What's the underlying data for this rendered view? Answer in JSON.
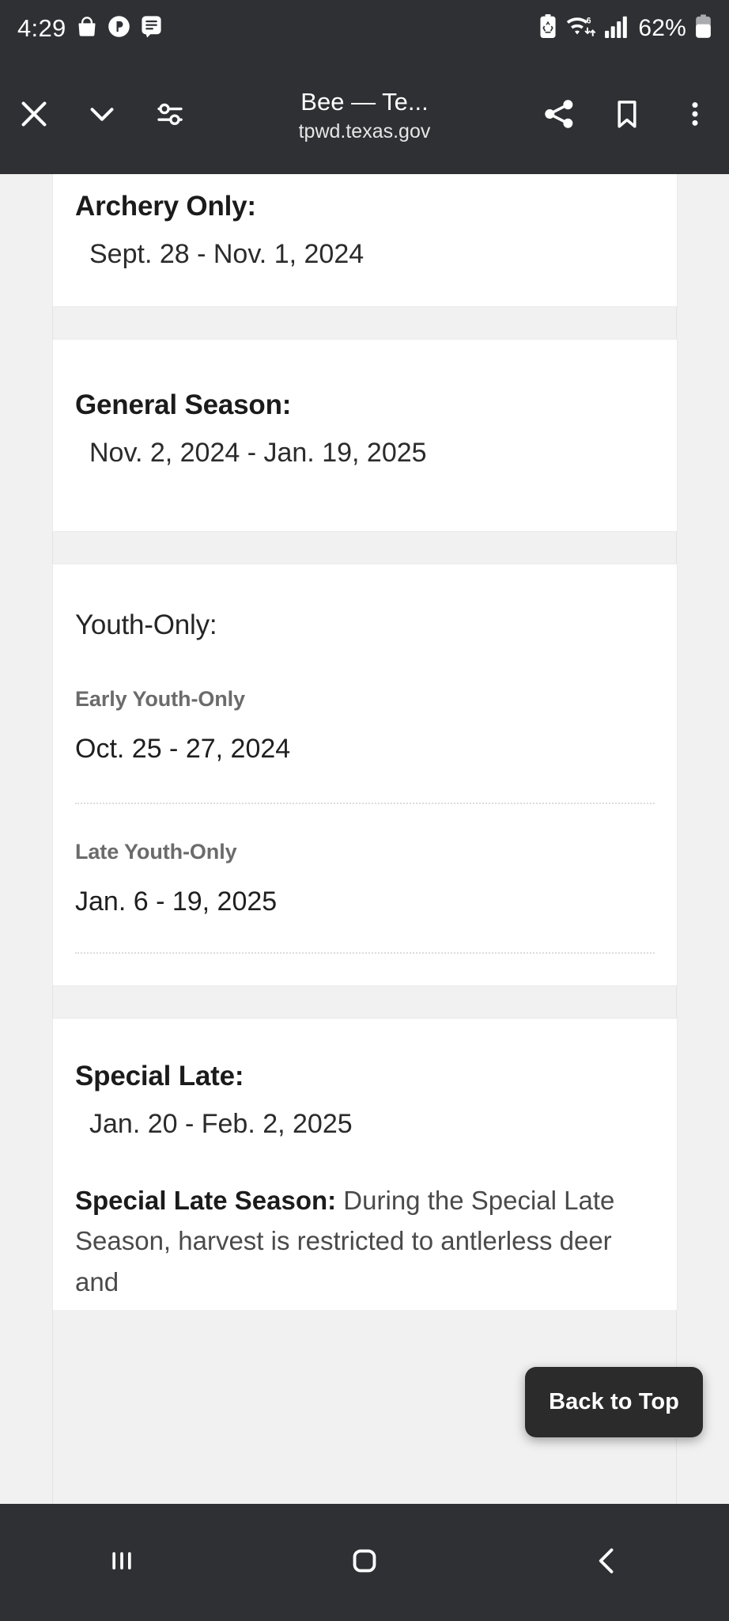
{
  "status_bar": {
    "time": "4:29",
    "battery_percent": "62%",
    "left_icons": [
      "shopping-bag-icon",
      "media-play-icon",
      "message-icon"
    ],
    "right_icons": [
      "battery-saver-icon",
      "wifi-6-icon",
      "cellular-signal-icon"
    ]
  },
  "toolbar": {
    "close_label": "close-icon",
    "collapse_label": "chevron-down-icon",
    "tune_label": "tune-icon",
    "page_title": "Bee — Te...",
    "page_url": "tpwd.texas.gov",
    "share_label": "share-icon",
    "bookmark_label": "bookmark-icon",
    "overflow_label": "more-vertical-icon"
  },
  "cards": [
    {
      "title": "Archery Only:",
      "title_bold": true,
      "date": "Sept. 28 - Nov. 1, 2024"
    },
    {
      "title": "General Season:",
      "title_bold": true,
      "date": "Nov. 2, 2024 - Jan. 19, 2025"
    },
    {
      "title": "Youth-Only:",
      "title_bold": false,
      "sections": [
        {
          "label": "Early Youth-Only",
          "date": "Oct. 25 - 27, 2024"
        },
        {
          "label": "Late Youth-Only",
          "date": "Jan. 6 - 19, 2025"
        }
      ]
    },
    {
      "title": "Special Late:",
      "title_bold": true,
      "date": "Jan. 20 - Feb. 2, 2025",
      "paragraph_bold_lead": "Special Late Season:",
      "paragraph_text": " During the Special Late Season, harvest is restricted to antlerless deer and"
    }
  ],
  "floating": {
    "back_to_top_label": "Back to Top"
  },
  "nav_bar": {
    "recents_label": "recents-icon",
    "home_label": "home-icon",
    "back_label": "back-icon"
  },
  "colors": {
    "chrome_dark": "#2e3034",
    "page_bg": "#f1f1f1",
    "card_bg": "#ffffff",
    "heading": "#1b1b1b",
    "sub_label": "#6b6b6b",
    "back_to_top_bg": "#2b2b2b"
  }
}
